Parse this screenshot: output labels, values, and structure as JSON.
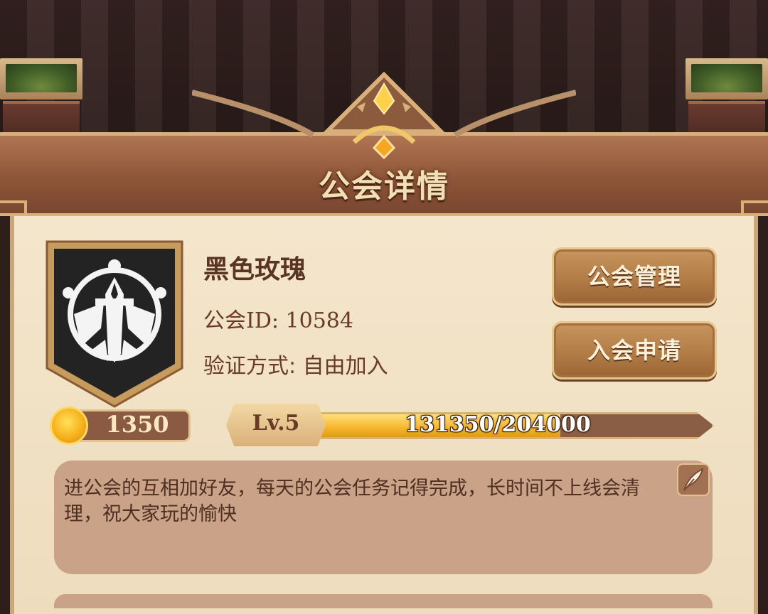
{
  "page": {
    "title": "公会详情"
  },
  "guild": {
    "name": "黑色玫瑰",
    "id_line": "公会ID: 10584",
    "verify_line": "验证方式: 自由加入",
    "coins": "1350",
    "level": "Lv.5",
    "xp_text": "131350/204000",
    "xp_fraction": 0.6439,
    "notice": "进公会的互相加好友，每天的公会任务记得完成，长时间不上线会清理，祝大家玩的愉快"
  },
  "buttons": {
    "manage": "公会管理",
    "apply": "入会申请"
  },
  "icons": {
    "emblem": "guild-emblem-sword-icon",
    "coin": "coin-icon",
    "edit": "quill-edit-icon",
    "crest": "crown-gem-icon"
  },
  "colors": {
    "header": "#8e5638",
    "parchment": "#f4e6cc",
    "button": "#b07a45",
    "xp_fill": "#f6b52c",
    "notice_bg": "#c9a287"
  }
}
